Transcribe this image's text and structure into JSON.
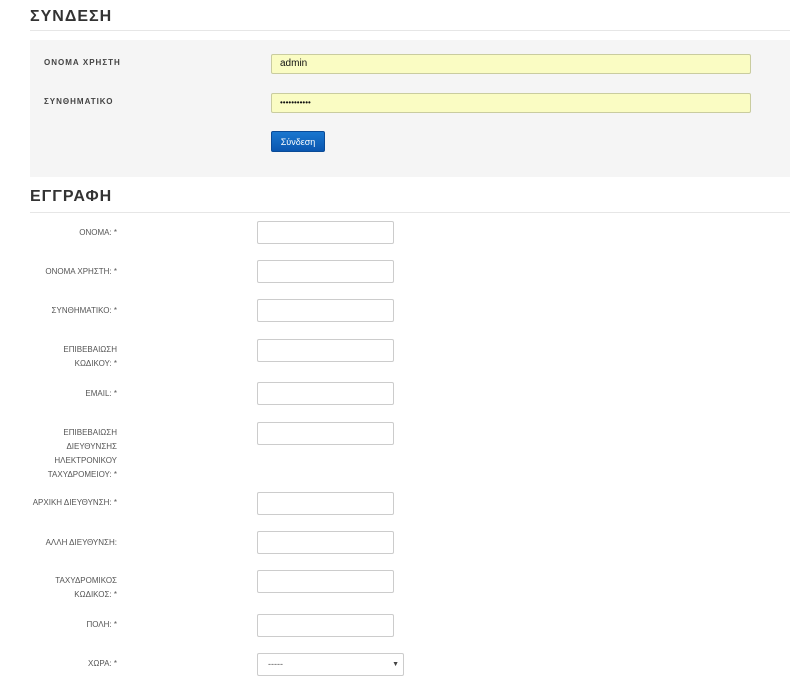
{
  "login": {
    "title": "ΣΥΝΔΕΣΗ",
    "username_label": "ΟΝΟΜΑ ΧΡΗΣΤΗ",
    "username_value": "admin",
    "password_label": "ΣΥΝΘΗΜΑΤΙΚΟ",
    "password_value": "•••••••••••",
    "submit_label": "Σύνδεση",
    "input_bg": "#fafcc3",
    "button_color": "#0a56b0"
  },
  "register": {
    "title": "ΕΓΓΡΑΦΗ",
    "fields": [
      {
        "label": "ΟΝΟΜΑ: *"
      },
      {
        "label": "ΟΝΟΜΑ ΧΡΗΣΤΗ: *"
      },
      {
        "label": "ΣΥΝΘΗΜΑΤΙΚΟ: *"
      },
      {
        "label_lines": [
          "ΕΠΙΒΕΒΑΙΩΣΗ",
          "ΚΩΔΙΚΟΥ: *"
        ]
      },
      {
        "label": "EMAIL: *"
      },
      {
        "label_lines": [
          "ΕΠΙΒΕΒΑΙΩΣΗ",
          "ΔΙΕΥΘΥΝΣΗΣ",
          "ΗΛΕΚΤΡΟΝΙΚΟΥ",
          "ΤΑΧΥΔΡΟΜΕΙΟΥ: *"
        ]
      },
      {
        "label": "ΑΡΧΙΚΗ ΔΙΕΥΘΥΝΣΗ: *"
      },
      {
        "label": "ΑΛΛΗ ΔΙΕΥΘΥΝΣΗ:"
      },
      {
        "label_lines": [
          "ΤΑΧΥΔΡΟΜΙΚΟΣ",
          "ΚΩΔΙΚΟΣ: *"
        ]
      },
      {
        "label": "ΠΟΛΗ: *"
      },
      {
        "label": "ΧΩΡΑ: *",
        "selected": "-----"
      }
    ]
  },
  "icons": {
    "select_caret": "chevron-down-icon",
    "caret_glyph": "▼"
  }
}
